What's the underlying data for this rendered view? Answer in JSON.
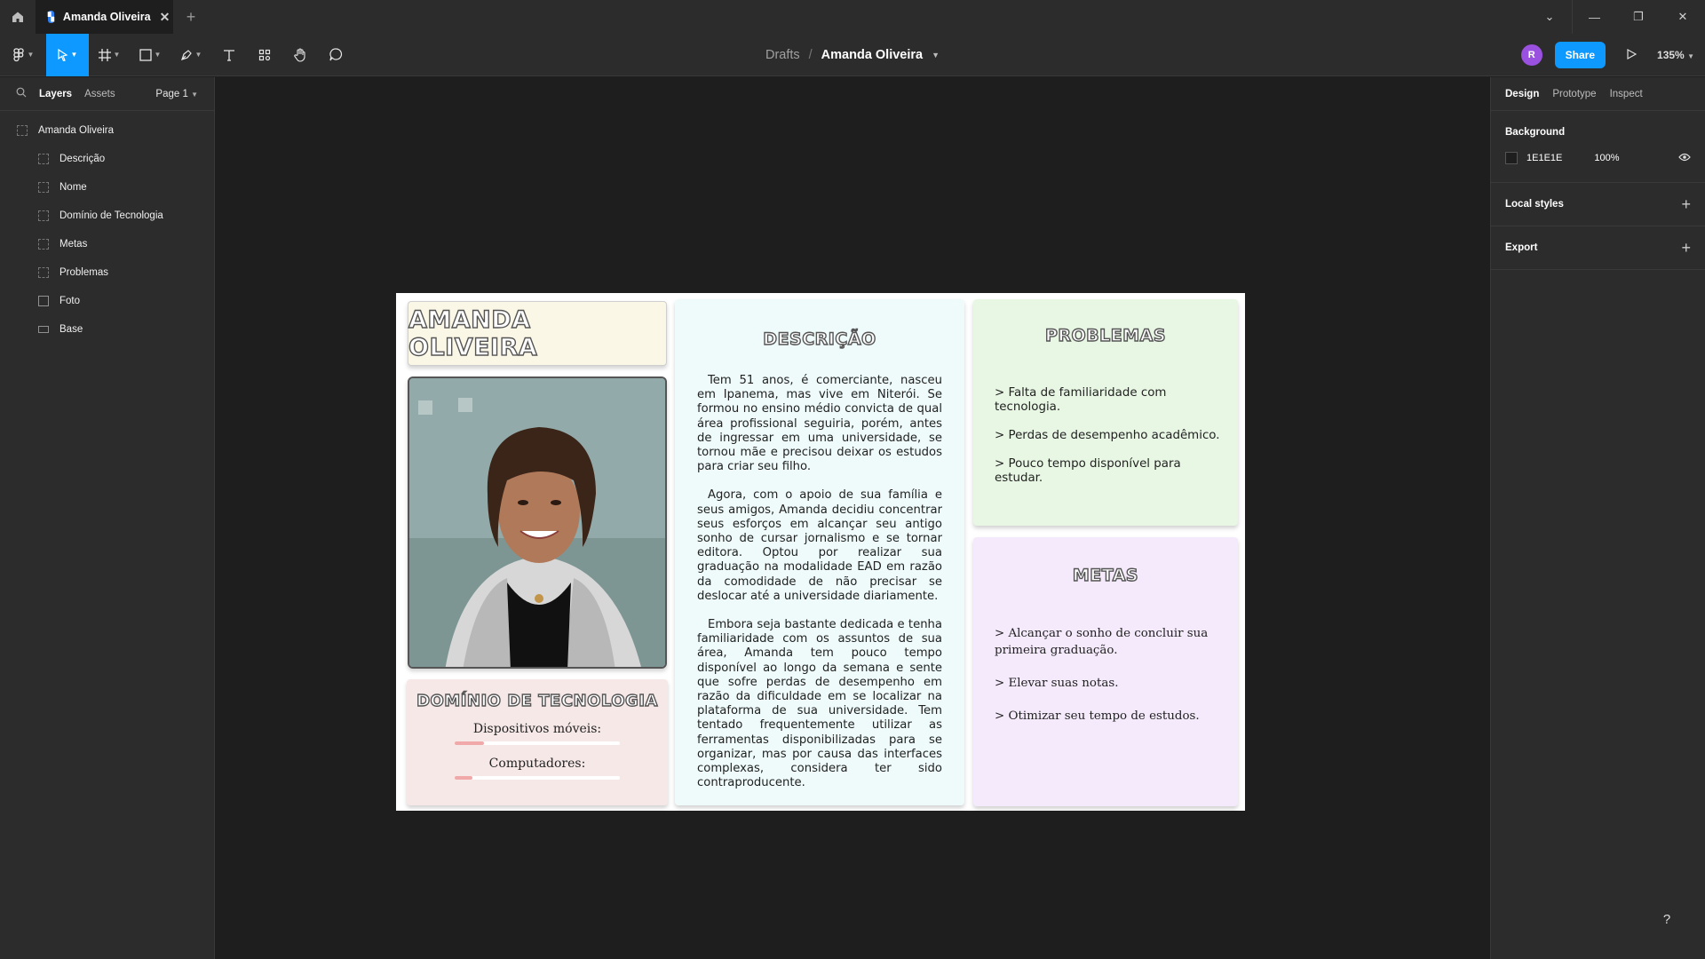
{
  "titlebar": {
    "tab_label": "Amanda Oliveira",
    "close_glyph": "✕",
    "newtab_glyph": "+"
  },
  "toolbar": {
    "breadcrumb_root": "Drafts",
    "breadcrumb_sep": "/",
    "file_name": "Amanda Oliveira",
    "avatar_initial": "R",
    "share_label": "Share",
    "zoom": "135%"
  },
  "left_panel": {
    "tabs": {
      "layers": "Layers",
      "assets": "Assets",
      "page": "Page 1"
    },
    "layers": [
      {
        "label": "Amanda Oliveira",
        "icon": "frame"
      },
      {
        "label": "Descrição",
        "icon": "frame"
      },
      {
        "label": "Nome",
        "icon": "frame"
      },
      {
        "label": "Domínio de Tecnologia",
        "icon": "frame"
      },
      {
        "label": "Metas",
        "icon": "frame"
      },
      {
        "label": "Problemas",
        "icon": "frame"
      },
      {
        "label": "Foto",
        "icon": "image"
      },
      {
        "label": "Base",
        "icon": "rectangle"
      }
    ]
  },
  "right_panel": {
    "tabs": {
      "design": "Design",
      "prototype": "Prototype",
      "inspect": "Inspect"
    },
    "background": {
      "title": "Background",
      "hex": "1E1E1E",
      "opacity": "100%"
    },
    "local_styles": "Local styles",
    "export": "Export"
  },
  "canvas": {
    "name_title": "AMANDA OLIVEIRA",
    "descricao": {
      "title": "DESCRIÇÃO",
      "paragraphs": [
        "Tem 51 anos, é comerciante, nasceu em Ipanema, mas vive em Niterói. Se formou no ensino médio convicta de qual área profissional seguiria, porém, antes de ingressar em uma universidade, se tornou mãe e precisou deixar os estudos para criar seu filho.",
        "Agora, com o apoio de sua família e seus amigos, Amanda decidiu concentrar seus esforços em alcançar seu antigo sonho de cursar jornalismo e se tornar editora. Optou por realizar sua graduação na modalidade EAD em razão da comodidade de não precisar se deslocar até a universidade diariamente.",
        "Embora seja bastante dedicada e tenha familiaridade com os assuntos de sua área, Amanda tem pouco tempo disponível ao longo da semana e sente que sofre perdas de desempenho em razão da dificuldade em se localizar na plataforma de sua universidade. Tem tentado frequentemente utilizar as ferramentas disponibilizadas para se organizar, mas por causa das interfaces complexas, considera ter sido contraproducente."
      ]
    },
    "problemas": {
      "title": "PROBLEMAS",
      "items": [
        ">  Falta de familiaridade com tecnologia.",
        ">  Perdas de desempenho acadêmico.",
        ">  Pouco tempo disponível para estudar."
      ]
    },
    "metas": {
      "title": "METAS",
      "items": [
        ">  Alcançar o sonho de concluir sua primeira graduação.",
        ">  Elevar suas notas.",
        ">  Otimizar seu tempo de estudos."
      ]
    },
    "dominio": {
      "title": "DOMÍNIO DE TECNOLOGIA",
      "skills": [
        {
          "label": "Dispositivos móveis:",
          "level": 0.18
        },
        {
          "label": "Computadores:",
          "level": 0.11
        }
      ]
    }
  },
  "help_label": "?"
}
